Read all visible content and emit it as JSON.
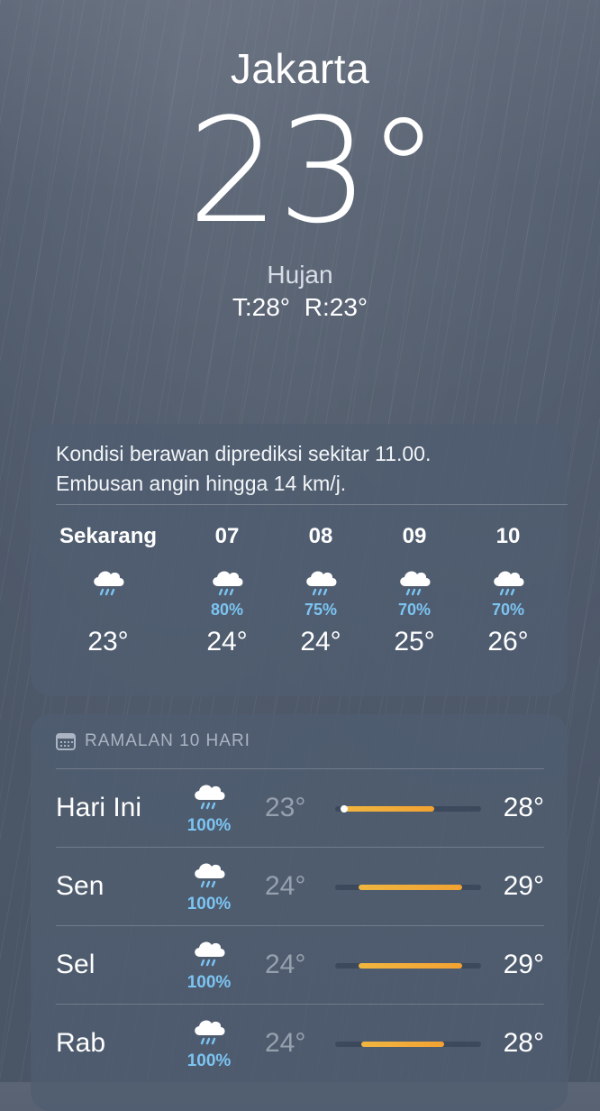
{
  "location": {
    "city": "Jakarta",
    "temperature": "23°",
    "condition": "Hujan",
    "high_low": "T:28°  R:23°"
  },
  "hourly_card": {
    "summary_line1": "Kondisi berawan diprediksi sekitar 11.00.",
    "summary_line2": "Embusan angin hingga 14 km/j.",
    "hours": [
      {
        "label": "Sekarang",
        "icon": "rain-cloud-icon",
        "precip": "",
        "temp": "23°"
      },
      {
        "label": "07",
        "icon": "rain-cloud-icon",
        "precip": "80%",
        "temp": "24°"
      },
      {
        "label": "08",
        "icon": "rain-cloud-icon",
        "precip": "75%",
        "temp": "24°"
      },
      {
        "label": "09",
        "icon": "rain-cloud-icon",
        "precip": "70%",
        "temp": "25°"
      },
      {
        "label": "10",
        "icon": "rain-cloud-icon",
        "precip": "70%",
        "temp": "26°"
      }
    ]
  },
  "daily_card": {
    "header_icon": "calendar-icon",
    "header": "RAMALAN 10 HARI",
    "range_bar_color": "#f2a232",
    "days": [
      {
        "day": "Hari Ini",
        "icon": "rain-cloud-icon",
        "precip": "100%",
        "low": "23°",
        "high": "28°",
        "bar_start": 0.06,
        "bar_end": 0.68,
        "current_marker": 0.06
      },
      {
        "day": "Sen",
        "icon": "rain-cloud-icon",
        "precip": "100%",
        "low": "24°",
        "high": "29°",
        "bar_start": 0.16,
        "bar_end": 0.87
      },
      {
        "day": "Sel",
        "icon": "rain-cloud-icon",
        "precip": "100%",
        "low": "24°",
        "high": "29°",
        "bar_start": 0.16,
        "bar_end": 0.87
      },
      {
        "day": "Rab",
        "icon": "rain-cloud-icon",
        "precip": "100%",
        "low": "24°",
        "high": "28°",
        "bar_start": 0.18,
        "bar_end": 0.75
      }
    ]
  }
}
